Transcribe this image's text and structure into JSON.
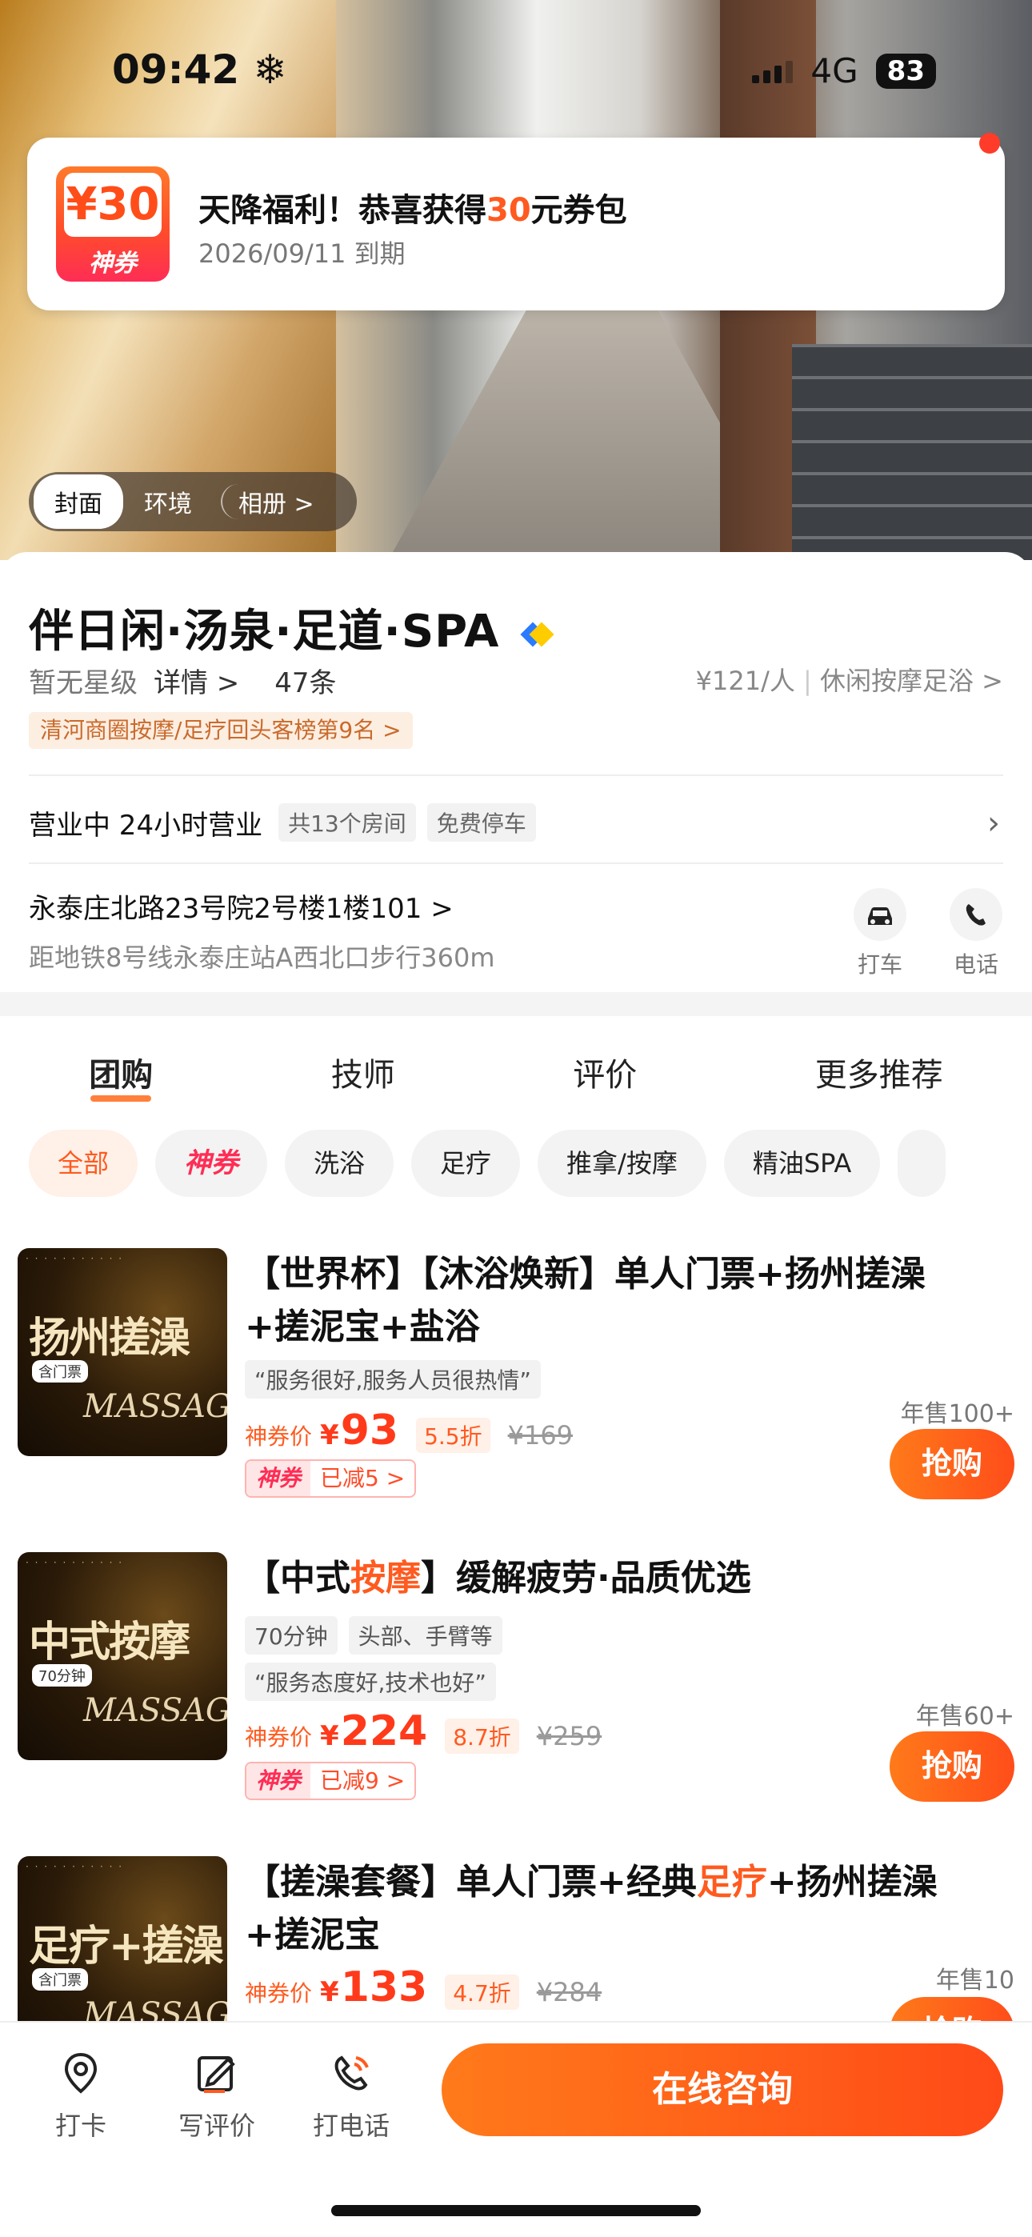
{
  "status_bar": {
    "time": "09:42",
    "network": "4G",
    "battery": "83"
  },
  "coupon_popup": {
    "badge_amount": "¥30",
    "badge_label": "神券",
    "title_prefix": "天降福利！恭喜获得",
    "title_highlight": "30",
    "title_suffix": "元券包",
    "expire": "2026/09/11 到期"
  },
  "hero_tabs": [
    "封面",
    "环境",
    "相册 >"
  ],
  "shop": {
    "name": "伴日闲·汤泉·足道·SPA",
    "star_level": "暂无星级",
    "detail_link": "详情 >",
    "review_count": "47条",
    "price_per_person": "¥121/人",
    "category": "休闲按摩足浴 >",
    "rank_tag": "清河商圈按摩/足疗回头客榜第9名 >",
    "status": "营业中 24小时营业",
    "rooms": "共13个房间",
    "parking": "免费停车",
    "address": "永泰庄北路23号院2号楼1楼101 >",
    "metro": "距地铁8号线永泰庄站A西北口步行360m",
    "actions": [
      {
        "icon": "car-icon",
        "label": "打车"
      },
      {
        "icon": "phone-icon",
        "label": "电话"
      }
    ]
  },
  "tabs": [
    "团购",
    "技师",
    "评价",
    "更多推荐"
  ],
  "filters": [
    "全部",
    "神券",
    "洗浴",
    "足疗",
    "推拿/按摩",
    "精油SPA"
  ],
  "deals": [
    {
      "image_title": "扬州搓澡",
      "image_tag": "含门票",
      "title_line1": "【世界杯】【沐浴焕新】单人门票+扬州搓澡",
      "title_line2": "+搓泥宝+盐浴",
      "tags": [],
      "quote": "“服务很好,服务人员很热情”",
      "price_prefix": "神券价",
      "price": "93",
      "discount": "5.5折",
      "original": "¥169",
      "coupon_label": "神券",
      "reduced": "已减5 >",
      "sold": "年售100+",
      "button": "抢购"
    },
    {
      "image_title": "中式按摩",
      "image_tag": "70分钟",
      "title_line1": "【中式按摩】缓解疲劳·品质优选",
      "title_line2": "",
      "tags": [
        "70分钟",
        "头部、手臂等"
      ],
      "quote": "“服务态度好,技术也好”",
      "price_prefix": "神券价",
      "price": "224",
      "discount": "8.7折",
      "original": "¥259",
      "coupon_label": "神券",
      "reduced": "已减9 >",
      "sold": "年售60+",
      "button": "抢购"
    },
    {
      "image_title": "足疗+搓澡",
      "image_tag": "含门票",
      "title_line1": "【搓澡套餐】单人门票+经典足疗+扬州搓澡",
      "title_line2": "+搓泥宝",
      "tags": [],
      "quote": "",
      "price_prefix": "神券价",
      "price": "133",
      "discount": "4.7折",
      "original": "¥284",
      "coupon_label": "神券",
      "reduced": "",
      "sold": "年售10",
      "button": "抢购"
    }
  ],
  "bottom_bar": {
    "items": [
      {
        "icon": "location-pin-icon",
        "label": "打卡"
      },
      {
        "icon": "write-review-icon",
        "label": "写评价"
      },
      {
        "icon": "phone-call-icon",
        "label": "打电话"
      }
    ],
    "consult": "在线咨询"
  },
  "colors": {
    "accent": "#FF5A1F",
    "coupon_red": "#FF2D55",
    "gray_chip": "#F2F2F2"
  }
}
